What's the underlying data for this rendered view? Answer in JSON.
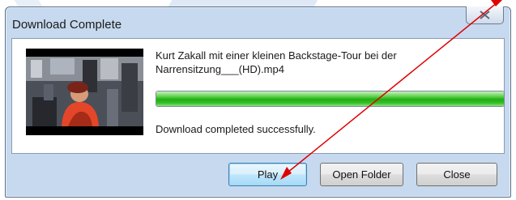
{
  "dialog": {
    "title": "Download Complete",
    "close_icon": "close-x-icon",
    "filename": "Kurt Zakall mit einer kleinen Backstage-Tour bei der Narrensitzung___(HD).mp4",
    "progress_fraction": 1.0,
    "status": "Download completed successfully.",
    "buttons": {
      "play": "Play",
      "open_folder": "Open Folder",
      "close": "Close"
    }
  },
  "colors": {
    "progress_green": "#1fae12",
    "annotation_red": "#e00000",
    "frame_blue": "#c6d9ee"
  }
}
